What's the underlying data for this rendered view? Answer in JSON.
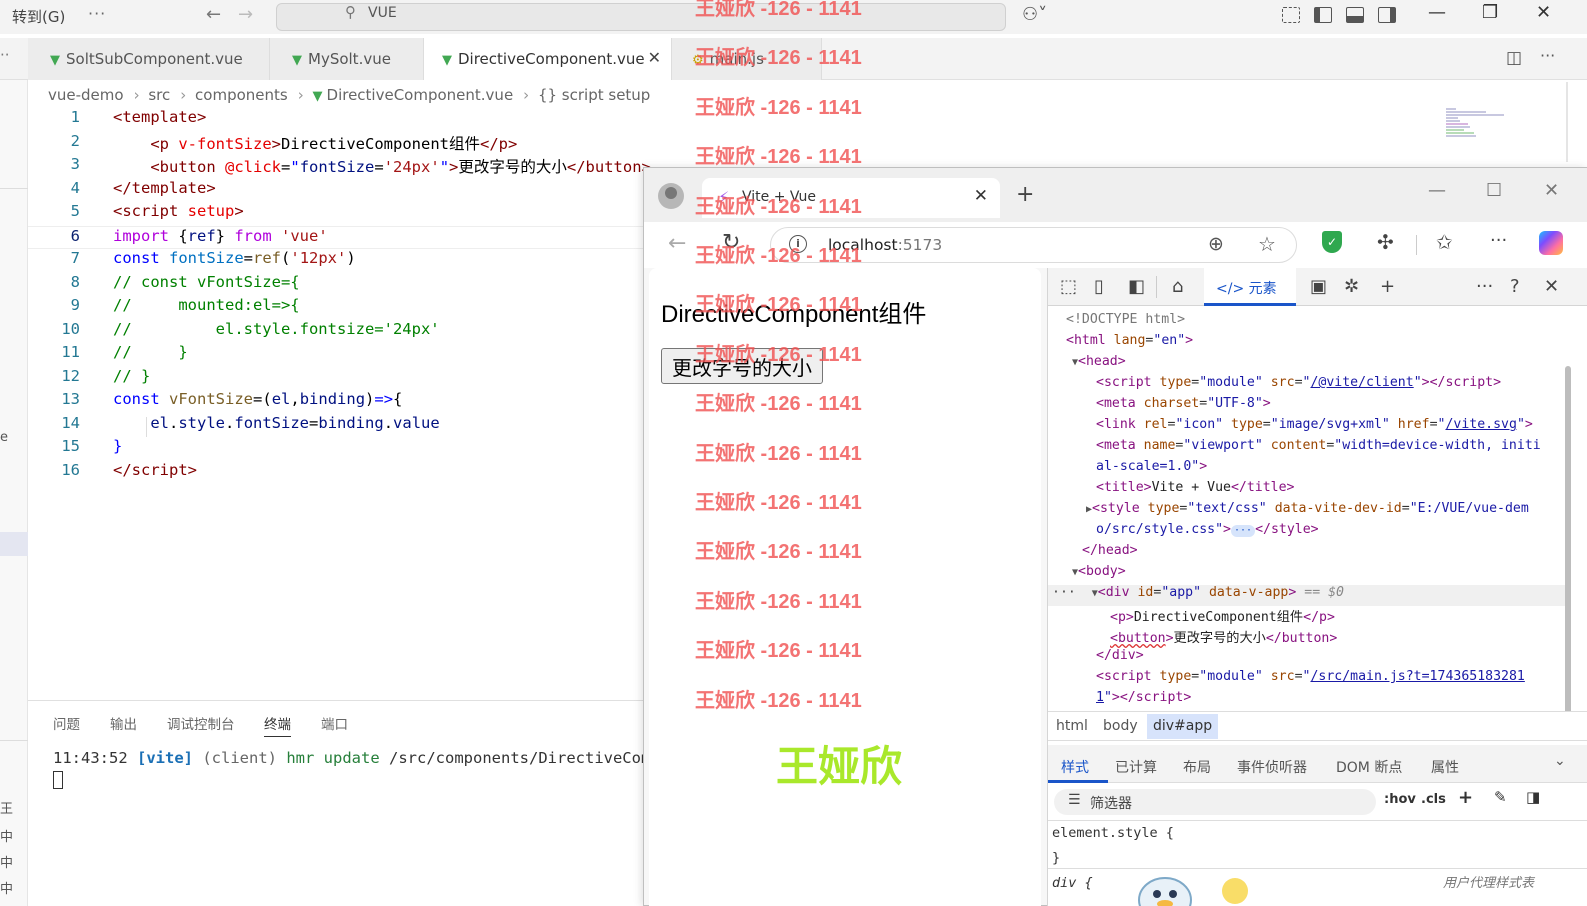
{
  "vscode": {
    "goto_label": "转到(G)",
    "more": "···",
    "search_text": "VUE",
    "tabs": [
      {
        "label": "SoltSubComponent.vue"
      },
      {
        "label": "MySolt.vue"
      },
      {
        "label": "DirectiveComponent.vue"
      },
      {
        "label": "main.js"
      }
    ],
    "tab_close": "✕",
    "breadcrumb": [
      "vue-demo",
      "src",
      "components",
      "DirectiveComponent.vue",
      "{} script setup"
    ],
    "activity_side_text": [
      "e",
      "王",
      "中",
      "中",
      "中"
    ],
    "line_numbers": [
      "1",
      "2",
      "3",
      "4",
      "5",
      "6",
      "7",
      "8",
      "9",
      "10",
      "11",
      "12",
      "13",
      "14",
      "15",
      "16"
    ],
    "panel_tabs": [
      "问题",
      "输出",
      "调试控制台",
      "终端",
      "端口"
    ],
    "terminal": {
      "time": "11:43:52",
      "tag": "[vite]",
      "client": "(client)",
      "hmr": "hmr update",
      "path": "/src/components/DirectiveCompon"
    }
  },
  "browser": {
    "tab_title": "Vite + Vue",
    "url_host": "localhost",
    "url_port": ":5173",
    "page": {
      "heading": "DirectiveComponent组件",
      "button": "更改字号的大小"
    }
  },
  "devtools": {
    "elements_tab": "元素",
    "doctype": "<!DOCTYPE html>",
    "crumbs": [
      "html",
      "body",
      "div#app"
    ],
    "subtabs": [
      "样式",
      "已计算",
      "布局",
      "事件侦听器",
      "DOM 断点",
      "属性"
    ],
    "filter_placeholder": "筛选器",
    "hov": ":hov",
    "cls": ".cls",
    "element_style_open": "element.style {",
    "element_style_close": "}",
    "div_rule": "div {",
    "ua_note": "用户代理样式表",
    "dom_selected_marker": "== $0",
    "p_text": "DirectiveComponent组件",
    "button_text": "更改字号的大小"
  },
  "watermark": {
    "text": "王娅欣 -126 - 1141",
    "big_text": "王娅欣",
    "count": 15
  },
  "colors": {
    "accent": "#1a55c9",
    "vue_green": "#42a853",
    "watermark_red": "#f05050",
    "watermark_green": "#a0e614"
  }
}
